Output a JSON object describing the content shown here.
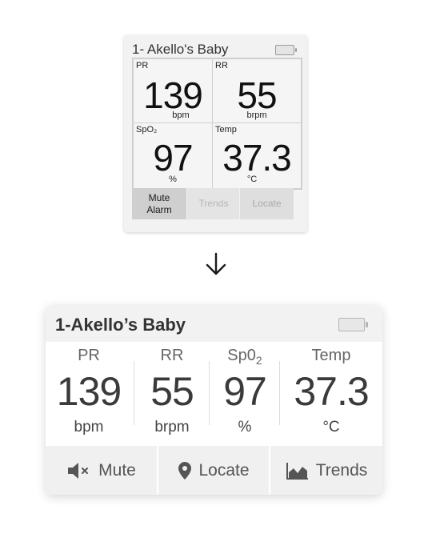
{
  "old_card": {
    "title": "1- Akello's Baby",
    "vitals": [
      {
        "label": "PR",
        "value": "139",
        "unit": "bpm"
      },
      {
        "label": "RR",
        "value": "55",
        "unit": "brpm"
      },
      {
        "label": "SpO₂",
        "value": "97",
        "unit": "%"
      },
      {
        "label": "Temp",
        "value": "37.3",
        "unit": "°C"
      }
    ],
    "buttons": {
      "mute_line1": "Mute",
      "mute_line2": "Alarm",
      "trends": "Trends",
      "locate": "Locate"
    }
  },
  "new_card": {
    "title": "1-Akello’s Baby",
    "vitals": [
      {
        "label": "PR",
        "value": "139",
        "unit": "bpm"
      },
      {
        "label": "RR",
        "value": "55",
        "unit": "brpm"
      },
      {
        "label": "Sp0",
        "label_sub": "2",
        "value": "97",
        "unit": "%"
      },
      {
        "label": "Temp",
        "value": "37.3",
        "unit": "°C"
      }
    ],
    "buttons": {
      "mute": "Mute",
      "locate": "Locate",
      "trends": "Trends"
    }
  },
  "icons": {
    "battery": "battery-icon",
    "arrow": "arrow-down-icon",
    "mute": "speaker-mute-icon",
    "locate": "map-pin-icon",
    "trends": "area-chart-icon"
  }
}
